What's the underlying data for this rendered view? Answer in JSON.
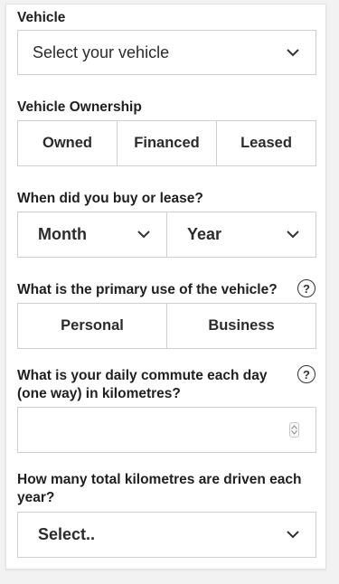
{
  "vehicle": {
    "label": "Vehicle",
    "placeholder": "Select your vehicle"
  },
  "ownership": {
    "label": "Vehicle Ownership",
    "options": [
      "Owned",
      "Financed",
      "Leased"
    ]
  },
  "purchase_date": {
    "label": "When did you buy or lease?",
    "month": "Month",
    "year": "Year"
  },
  "primary_use": {
    "label": "What is the primary use of the vehicle?",
    "options": [
      "Personal",
      "Business"
    ],
    "help": "?"
  },
  "commute": {
    "label_line1": "What is your daily commute each day",
    "label_line2": "(one way) in kilometres?",
    "value": "",
    "help": "?"
  },
  "annual_km": {
    "label_line1": "How many total kilometres are driven each",
    "label_line2": "year?",
    "placeholder": "Select.."
  }
}
